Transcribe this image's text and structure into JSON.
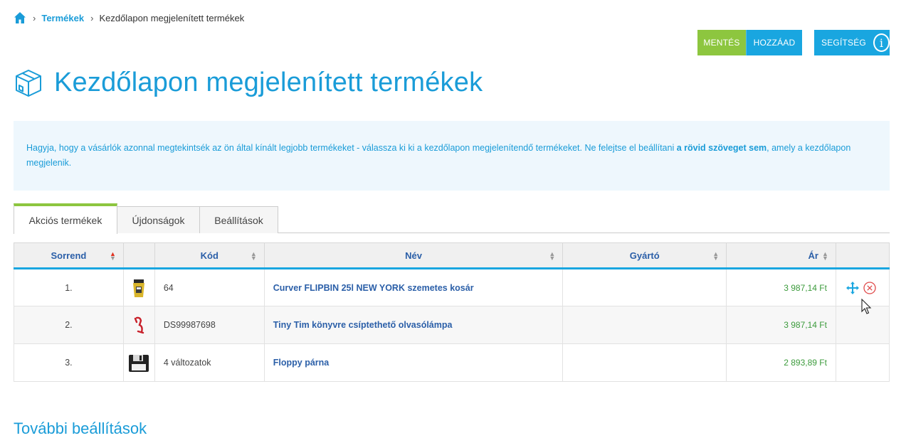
{
  "breadcrumb": {
    "home_icon": "home-icon",
    "link": "Termékek",
    "current": "Kezdőlapon megjelenített termékek"
  },
  "toolbar": {
    "save_label": "MENTÉS",
    "add_label": "HOZZÁAD",
    "help_label": "SEGÍTSÉG",
    "help_icon": "i"
  },
  "page": {
    "title": "Kezdőlapon megjelenített termékek",
    "title_icon": "box-icon"
  },
  "info": {
    "text_before": "Hagyja, hogy a vásárlók azonnal megtekintsék az ön által kínált legjobb termékeket - válassza ki ki a kezdőlapon megjelenítendő termékeket. Ne felejtse el beállítani ",
    "text_bold": "a rövid szöveget sem",
    "text_after": ", amely a kezdőlapon megjelenik."
  },
  "tabs": [
    {
      "label": "Akciós termékek",
      "active": true
    },
    {
      "label": "Újdonságok",
      "active": false
    },
    {
      "label": "Beállítások",
      "active": false
    }
  ],
  "table": {
    "columns": {
      "order": "Sorrend",
      "image": "",
      "code": "Kód",
      "name": "Név",
      "manufacturer": "Gyártó",
      "price": "Ár",
      "actions": ""
    },
    "rows": [
      {
        "order": "1.",
        "code": "64",
        "name": "Curver FLIPBIN 25l NEW YORK szemetes kosár",
        "manufacturer": "",
        "price": "3 987,14 Ft"
      },
      {
        "order": "2.",
        "code": "DS99987698",
        "name": "Tiny Tim könyvre csíptethető olvasólámpa",
        "manufacturer": "",
        "price": "3 987,14 Ft"
      },
      {
        "order": "3.",
        "code": "4 változatok",
        "name": "Floppy párna",
        "manufacturer": "",
        "price": "2 893,89 Ft"
      }
    ]
  },
  "more_settings": {
    "title": "További beállítások"
  },
  "colors": {
    "accent_blue": "#19a6e0",
    "accent_green": "#8dc63f",
    "price_green": "#3c9b3c",
    "link_blue": "#2b5fa8"
  }
}
